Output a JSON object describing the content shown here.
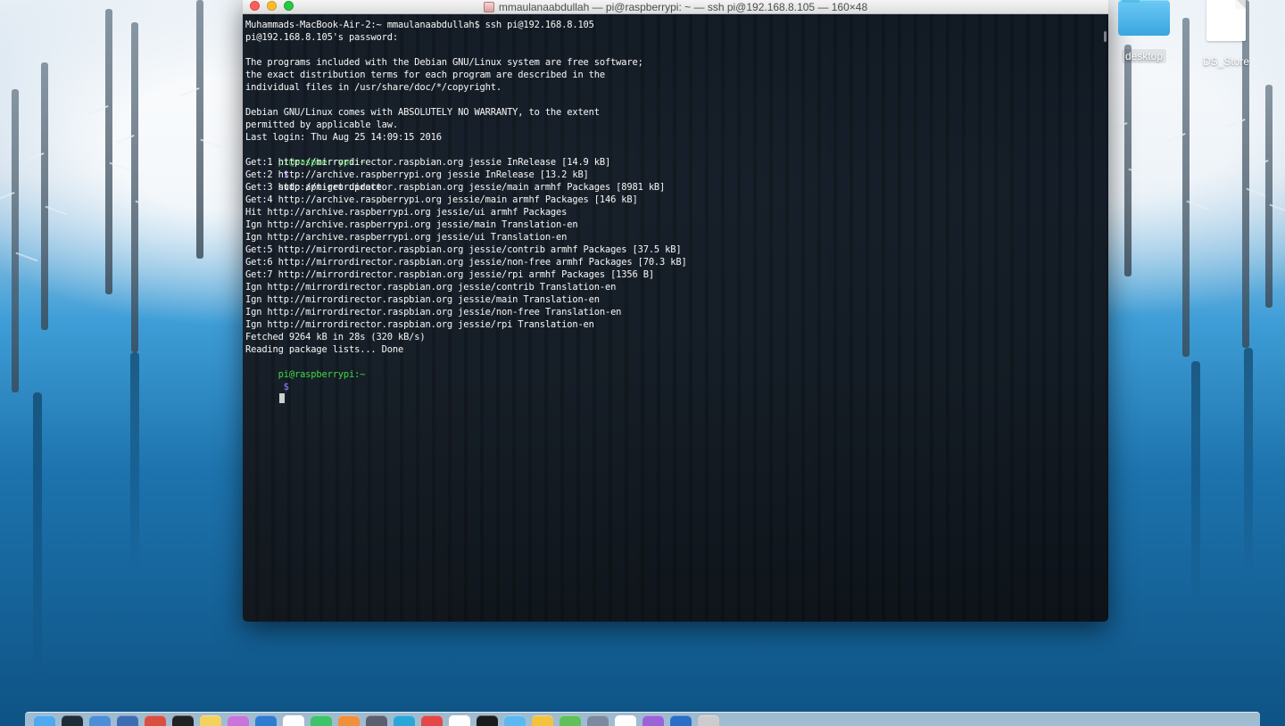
{
  "window": {
    "title": "mmaulanaabdullah — pi@raspberrypi: ~ — ssh pi@192.168.8.105 — 160×48"
  },
  "terminal": {
    "lines": {
      "line1": "Muhammads-MacBook-Air-2:~ mmaulanaabdullah$ ssh pi@192.168.8.105",
      "line2": "pi@192.168.8.105's password:",
      "line3": "",
      "line4": "The programs included with the Debian GNU/Linux system are free software;",
      "line5": "the exact distribution terms for each program are described in the",
      "line6": "individual files in /usr/share/doc/*/copyright.",
      "line7": "",
      "line8": "Debian GNU/Linux comes with ABSOLUTELY NO WARRANTY, to the extent",
      "line9": "permitted by applicable law.",
      "line10": "Last login: Thu Aug 25 14:09:15 2016",
      "line11_prompt": "pi@raspberrypi:~",
      "line11_arrow": "$",
      "line11_command": "sudo apt-get update",
      "line12": "Get:1 http://mirrordirector.raspbian.org jessie InRelease [14.9 kB]",
      "line13": "Get:2 http://archive.raspberrypi.org jessie InRelease [13.2 kB]",
      "line14": "Get:3 http://mirrordirector.raspbian.org jessie/main armhf Packages [8981 kB]",
      "line15": "Get:4 http://archive.raspberrypi.org jessie/main armhf Packages [146 kB]",
      "line16": "Hit http://archive.raspberrypi.org jessie/ui armhf Packages",
      "line17": "Ign http://archive.raspberrypi.org jessie/main Translation-en",
      "line18": "Ign http://archive.raspberrypi.org jessie/ui Translation-en",
      "line19": "Get:5 http://mirrordirector.raspbian.org jessie/contrib armhf Packages [37.5 kB]",
      "line20": "Get:6 http://mirrordirector.raspbian.org jessie/non-free armhf Packages [70.3 kB]",
      "line21": "Get:7 http://mirrordirector.raspbian.org jessie/rpi armhf Packages [1356 B]",
      "line22": "Ign http://mirrordirector.raspbian.org jessie/contrib Translation-en",
      "line23": "Ign http://mirrordirector.raspbian.org jessie/main Translation-en",
      "line24": "Ign http://mirrordirector.raspbian.org jessie/non-free Translation-en",
      "line25": "Ign http://mirrordirector.raspbian.org jessie/rpi Translation-en",
      "line26": "Fetched 9264 kB in 28s (320 kB/s)",
      "line27": "Reading package lists... Done",
      "line28_prompt": "pi@raspberrypi:~",
      "line28_arrow": "$"
    }
  },
  "desktop": {
    "icons": {
      "desktop": "desktop",
      "ds_store": "DS_Store"
    }
  },
  "colors": {
    "terminal_background": "#151e28",
    "prompt_green": "#37d43c",
    "prompt_arrow": "#8f7cff",
    "dock_background": "#d2e1ee"
  },
  "icons": {
    "close": "close-icon",
    "minimize": "minimize-icon",
    "zoom": "zoom-icon",
    "terminal": "terminal-icon",
    "folder": "folder-icon",
    "file": "file-icon"
  }
}
